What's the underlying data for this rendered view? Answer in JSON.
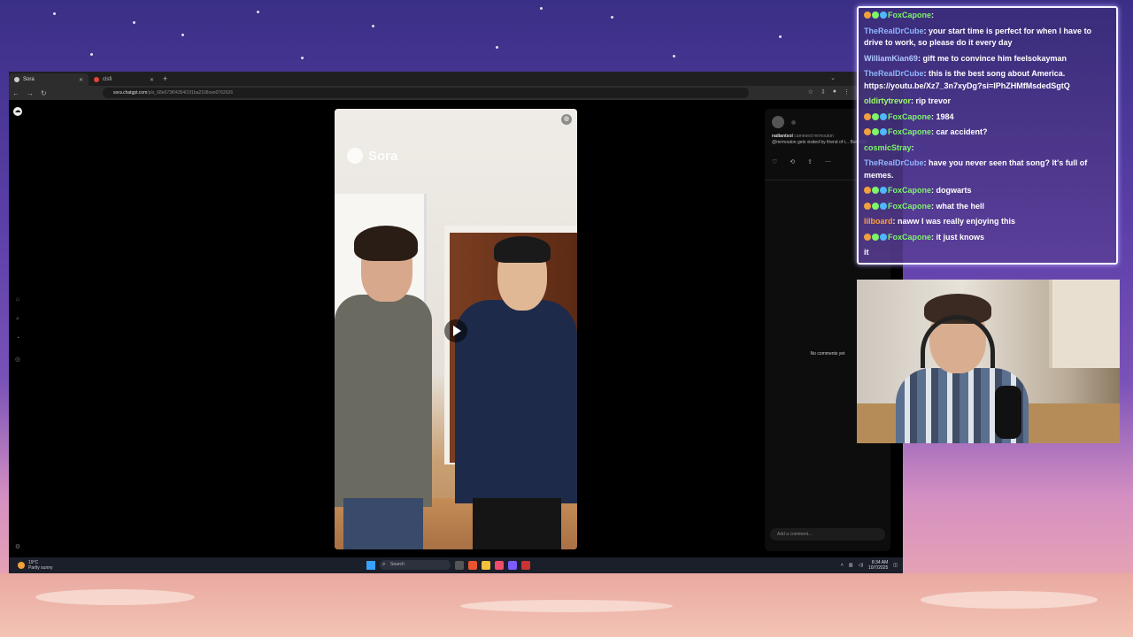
{
  "browser": {
    "tabs": [
      {
        "label": "Sora",
        "active": true
      },
      {
        "label": "clsfi",
        "active": false
      }
    ],
    "new_tab": "+",
    "url_domain": "sora.chatgpt.com",
    "url_path": "/p/s_68e673f0435401f1ba2168cee0762626"
  },
  "video": {
    "watermark": "Sora"
  },
  "post": {
    "username": "radiantsol",
    "cameo_text": "cameoed mrmouton",
    "caption": "@mrmouton gets visited by friend of t... Bombjin",
    "no_comments": "No comments yet",
    "comment_placeholder": "Add a comment..."
  },
  "taskbar": {
    "weather_temp": "19°C",
    "weather_desc": "Partly sunny",
    "search_placeholder": "Search",
    "time": "8:34 AM",
    "date": "10/7/2025"
  },
  "chat": {
    "messages": [
      {
        "author": "FoxCapone",
        "author_color": "#7cf56b",
        "badges": true,
        "text": ""
      },
      {
        "author": "TheRealDrCube",
        "author_color": "#8fb7ff",
        "badges": false,
        "text": "your start time is perfect for when I have to drive to work, so please do it every day"
      },
      {
        "author": "WilliamKian69",
        "author_color": "#b0c8ff",
        "badges": false,
        "text": "gift me to convince him feelsokayman"
      },
      {
        "author": "TheRealDrCube",
        "author_color": "#8fb7ff",
        "badges": false,
        "text": "this is the best song about America. https://youtu.be/Xz7_3n7xyDg?si=IPhZHMfMsdedSgtQ"
      },
      {
        "author": "oldirtytrevor",
        "author_color": "#9dff6b",
        "badges": false,
        "text": "rip trevor"
      },
      {
        "author": "FoxCapone",
        "author_color": "#7cf56b",
        "badges": true,
        "text": "1984"
      },
      {
        "author": "FoxCapone",
        "author_color": "#7cf56b",
        "badges": true,
        "text": "car accident?"
      },
      {
        "author": "cosmicStray",
        "author_color": "#7cf56b",
        "badges": false,
        "text": ""
      },
      {
        "author": "TheRealDrCube",
        "author_color": "#8fb7ff",
        "badges": false,
        "text": "have you never seen that song? It's full of memes."
      },
      {
        "author": "FoxCapone",
        "author_color": "#7cf56b",
        "badges": true,
        "text": "dogwarts"
      },
      {
        "author": "FoxCapone",
        "author_color": "#7cf56b",
        "badges": true,
        "text": "what the hell"
      },
      {
        "author": "lilboard",
        "author_color": "#ff9f3c",
        "badges": false,
        "text": "naww I was really enjoying this"
      },
      {
        "author": "FoxCapone",
        "author_color": "#7cf56b",
        "badges": true,
        "text": "it just knows"
      },
      {
        "author": "",
        "author_color": "#ff3b5c",
        "badges": false,
        "text": "it"
      }
    ]
  }
}
